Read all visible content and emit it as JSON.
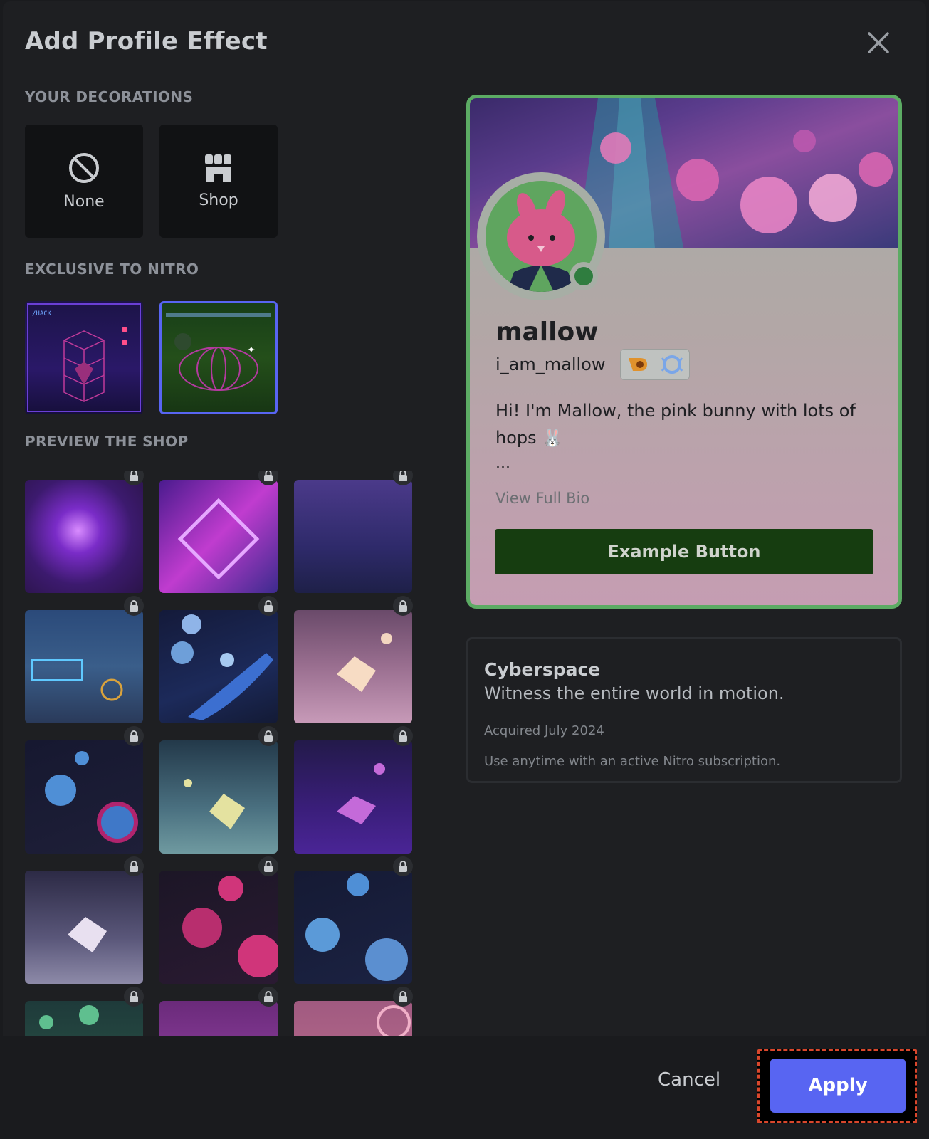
{
  "modal": {
    "title": "Add Profile Effect",
    "close_icon": "close-icon"
  },
  "sections": {
    "your_decorations": "YOUR DECORATIONS",
    "exclusive": "EXCLUSIVE TO NITRO",
    "preview_shop": "PREVIEW THE SHOP"
  },
  "decorations": [
    {
      "label": "None",
      "icon": "none-icon"
    },
    {
      "label": "Shop",
      "icon": "shop-icon"
    }
  ],
  "profile": {
    "display_name": "mallow",
    "username": "i_am_mallow",
    "bio_line1": "Hi! I'm Mallow, the pink bunny with lots of",
    "bio_line2": "hops 🐰",
    "ellipsis": "...",
    "view_full_bio": "View Full Bio",
    "example_button": "Example Button",
    "accent_color": "#5cab64"
  },
  "effect_info": {
    "name": "Cyberspace",
    "description": "Witness the entire world in motion.",
    "acquired": "Acquired July 2024",
    "usage": "Use anytime with an active Nitro subscription."
  },
  "footer": {
    "cancel": "Cancel",
    "apply": "Apply",
    "apply_color": "#5865f2"
  }
}
